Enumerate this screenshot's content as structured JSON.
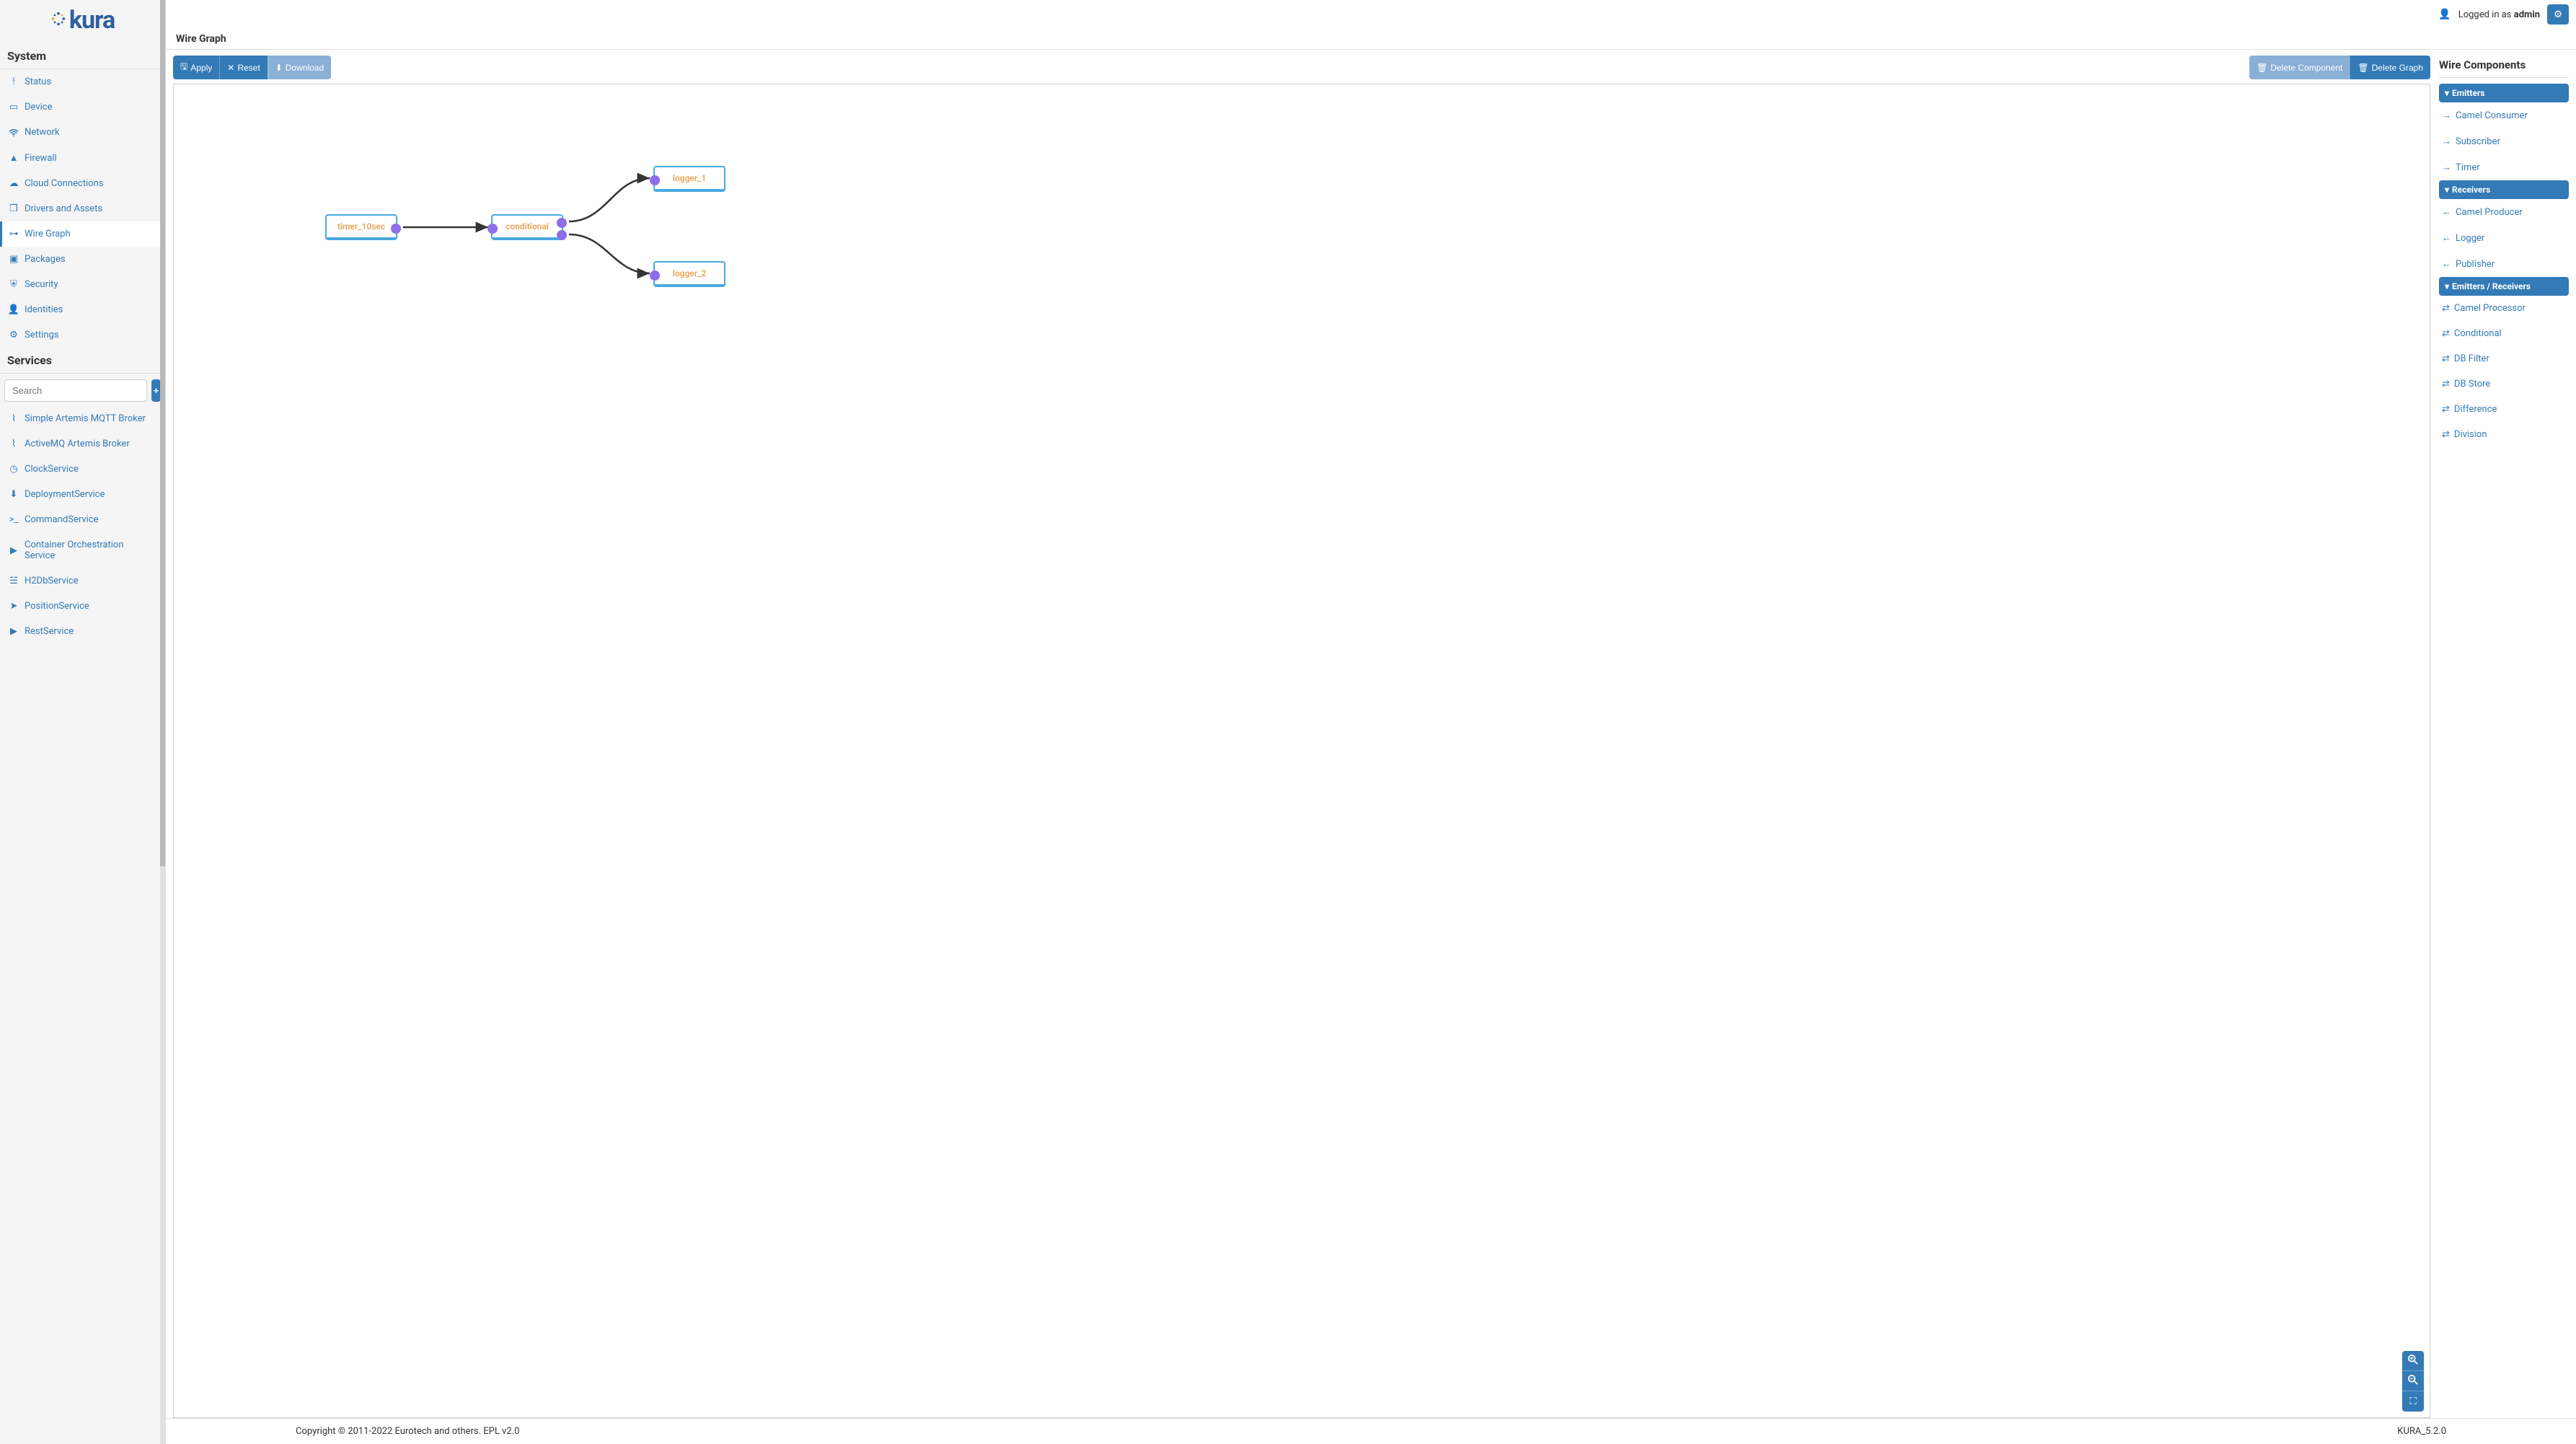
{
  "brand": "kura",
  "topbar": {
    "logged_in_prefix": "Logged in as",
    "user": "admin"
  },
  "sidebar": {
    "system_header": "System",
    "services_header": "Services",
    "search_placeholder": "Search",
    "items": [
      {
        "icon": "exclaim",
        "label": "Status"
      },
      {
        "icon": "hdd",
        "label": "Device"
      },
      {
        "icon": "wifi",
        "label": "Network"
      },
      {
        "icon": "fire",
        "label": "Firewall"
      },
      {
        "icon": "cloud",
        "label": "Cloud Connections"
      },
      {
        "icon": "cube",
        "label": "Drivers and Assets"
      },
      {
        "icon": "sitemap",
        "label": "Wire Graph"
      },
      {
        "icon": "briefcase",
        "label": "Packages"
      },
      {
        "icon": "shield",
        "label": "Security"
      },
      {
        "icon": "user",
        "label": "Identities"
      },
      {
        "icon": "gear",
        "label": "Settings"
      }
    ],
    "active_index": 6,
    "services": [
      {
        "icon": "rss",
        "label": "Simple Artemis MQTT Broker"
      },
      {
        "icon": "rss",
        "label": "ActiveMQ Artemis Broker"
      },
      {
        "icon": "clock",
        "label": "ClockService"
      },
      {
        "icon": "download",
        "label": "DeploymentService"
      },
      {
        "icon": "terminal",
        "label": "CommandService"
      },
      {
        "icon": "play",
        "label": "Container Orchestration Service"
      },
      {
        "icon": "database",
        "label": "H2DbService"
      },
      {
        "icon": "location",
        "label": "PositionService"
      },
      {
        "icon": "play",
        "label": "RestService"
      }
    ]
  },
  "page": {
    "title": "Wire Graph"
  },
  "toolbar": {
    "apply": "Apply",
    "reset": "Reset",
    "download": "Download",
    "delete_component": "Delete Component",
    "delete_graph": "Delete Graph"
  },
  "nodes": {
    "timer": "timer_10sec",
    "conditional": "conditional",
    "logger1": "logger_1",
    "logger2": "logger_2"
  },
  "right_panel": {
    "title": "Wire Components",
    "categories": [
      {
        "name": "Emitters",
        "items": [
          "Camel Consumer",
          "Subscriber",
          "Timer"
        ]
      },
      {
        "name": "Receivers",
        "items": [
          "Camel Producer",
          "Logger",
          "Publisher"
        ]
      },
      {
        "name": "Emitters / Receivers",
        "items": [
          "Camel Processor",
          "Conditional",
          "DB Filter",
          "DB Store",
          "Difference",
          "Division"
        ]
      }
    ]
  },
  "footer": {
    "copyright": "Copyright © 2011-2022 Eurotech and others. EPL v2.0",
    "version": "KURA_5.2.0"
  }
}
